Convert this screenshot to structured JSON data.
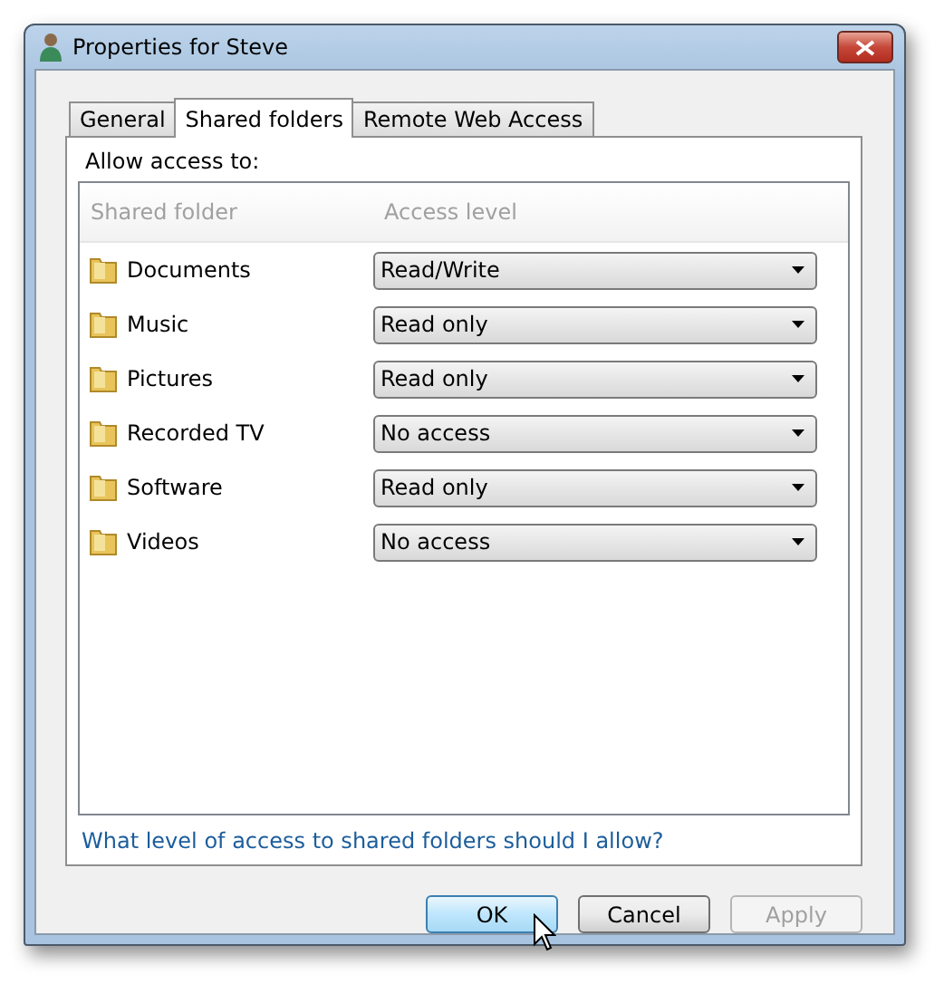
{
  "window": {
    "title": "Properties for Steve"
  },
  "tabs": [
    {
      "label": "General",
      "selected": false
    },
    {
      "label": "Shared folders",
      "selected": true
    },
    {
      "label": "Remote Web Access",
      "selected": false
    }
  ],
  "section_label": "Allow access to:",
  "table": {
    "columns": [
      "Shared folder",
      "Access level"
    ],
    "rows": [
      {
        "folder": "Documents",
        "access": "Read/Write"
      },
      {
        "folder": "Music",
        "access": "Read only"
      },
      {
        "folder": "Pictures",
        "access": "Read only"
      },
      {
        "folder": "Recorded TV",
        "access": "No access"
      },
      {
        "folder": "Software",
        "access": "Read only"
      },
      {
        "folder": "Videos",
        "access": "No access"
      }
    ]
  },
  "help_link": "What level of access to shared folders should I allow?",
  "buttons": [
    {
      "label": "OK",
      "disabled": false,
      "hovered": true
    },
    {
      "label": "Cancel",
      "disabled": false,
      "hovered": false
    },
    {
      "label": "Apply",
      "disabled": true,
      "hovered": false
    }
  ]
}
